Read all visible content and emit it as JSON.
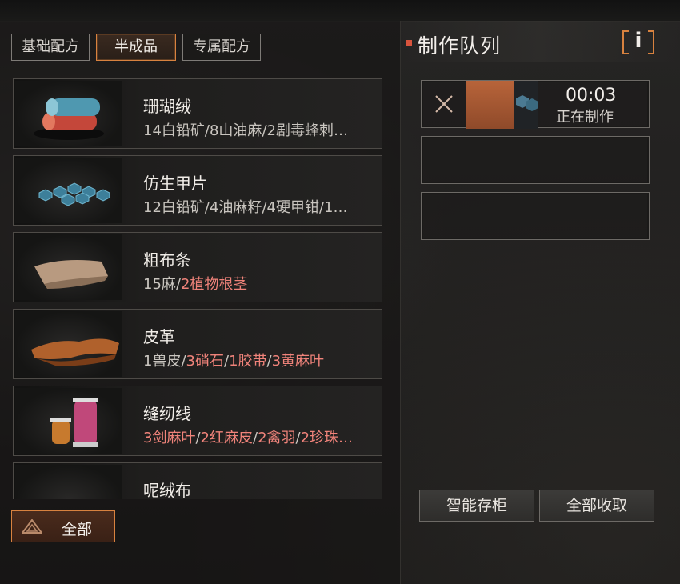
{
  "tabs": [
    {
      "label": "基础配方",
      "active": false
    },
    {
      "label": "半成品",
      "active": true
    },
    {
      "label": "专属配方",
      "active": false
    }
  ],
  "recipes": [
    {
      "name": "珊瑚绒",
      "icon": "towel-roll-icon",
      "reqs": [
        {
          "text": "14白铅矿",
          "ok": true
        },
        {
          "text": "8山油麻",
          "ok": true
        },
        {
          "text": "2剧毒蜂刺",
          "ok": true
        },
        {
          "text": "…",
          "ok": true
        }
      ],
      "truncated": true
    },
    {
      "name": "仿生甲片",
      "icon": "hex-plate-icon",
      "reqs": [
        {
          "text": "12白铅矿",
          "ok": true
        },
        {
          "text": "4油麻籽",
          "ok": true
        },
        {
          "text": "4硬甲钳",
          "ok": true
        },
        {
          "text": "1…",
          "ok": true
        }
      ],
      "truncated": true
    },
    {
      "name": "粗布条",
      "icon": "cloth-strip-icon",
      "reqs": [
        {
          "text": "15麻",
          "ok": true
        },
        {
          "text": "2植物根茎",
          "ok": false
        }
      ]
    },
    {
      "name": "皮革",
      "icon": "leather-icon",
      "reqs": [
        {
          "text": "1兽皮",
          "ok": true
        },
        {
          "text": "3硝石",
          "ok": false
        },
        {
          "text": "1胶带",
          "ok": false
        },
        {
          "text": "3黄麻叶",
          "ok": false
        }
      ]
    },
    {
      "name": "缝纫线",
      "icon": "thread-spool-icon",
      "reqs": [
        {
          "text": "3剑麻叶",
          "ok": false
        },
        {
          "text": "2红麻皮",
          "ok": false
        },
        {
          "text": "2禽羽",
          "ok": false
        },
        {
          "text": "2珍珠…",
          "ok": false
        }
      ]
    },
    {
      "name": "呢绒布",
      "icon": "wool-roll-icon",
      "reqs": []
    }
  ],
  "filter_button": {
    "label": "全部"
  },
  "queue": {
    "title": "制作队列",
    "info_glyph": "i",
    "slots": [
      {
        "time": "00:03",
        "status": "正在制作",
        "filled": true
      },
      {
        "filled": false
      },
      {
        "filled": false
      }
    ]
  },
  "bottom_buttons": {
    "smart_storage": "智能存柜",
    "collect_all": "全部收取"
  },
  "colors": {
    "accent": "#d8823f",
    "missing": "#f0837a",
    "bullet": "#d9543d"
  }
}
